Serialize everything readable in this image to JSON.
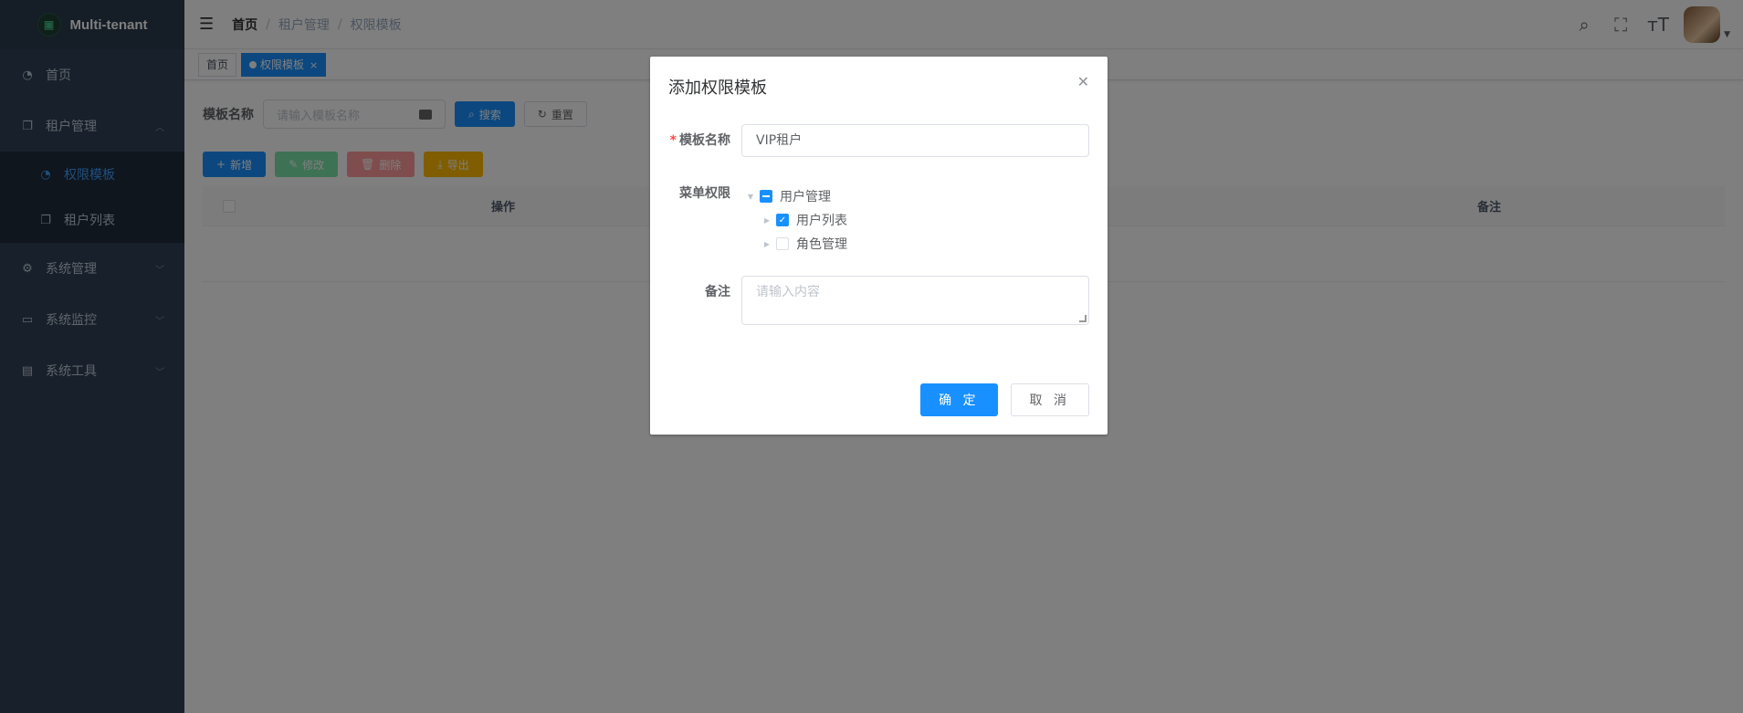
{
  "app": {
    "title": "Multi-tenant"
  },
  "sidebar": {
    "items": [
      {
        "label": "首页",
        "icon": "dashboard-icon"
      },
      {
        "label": "租户管理",
        "icon": "copy-icon",
        "expanded": true,
        "children": [
          {
            "label": "权限模板",
            "icon": "dashboard-icon",
            "active": true
          },
          {
            "label": "租户列表",
            "icon": "copy-icon"
          }
        ]
      },
      {
        "label": "系统管理",
        "icon": "gear-icon"
      },
      {
        "label": "系统监控",
        "icon": "monitor-icon"
      },
      {
        "label": "系统工具",
        "icon": "toolbox-icon"
      }
    ]
  },
  "breadcrumb": [
    "首页",
    "租户管理",
    "权限模板"
  ],
  "tags": [
    {
      "label": "首页",
      "active": false
    },
    {
      "label": "权限模板",
      "active": true
    }
  ],
  "search": {
    "label": "模板名称",
    "placeholder": "请输入模板名称",
    "search_btn": "搜索",
    "reset_btn": "重置"
  },
  "toolbar": {
    "add": "新增",
    "edit": "修改",
    "delete": "删除",
    "export": "导出"
  },
  "table": {
    "columns": [
      "操作",
      "备注"
    ]
  },
  "dialog": {
    "title": "添加权限模板",
    "name_label": "模板名称",
    "name_value": "VIP租户",
    "menu_label": "菜单权限",
    "tree": [
      {
        "label": "用户管理",
        "state": "half",
        "expanded": true,
        "children": [
          {
            "label": "用户列表",
            "state": "checked"
          },
          {
            "label": "角色管理",
            "state": "unchecked"
          }
        ]
      }
    ],
    "remark_label": "备注",
    "remark_placeholder": "请输入内容",
    "ok": "确 定",
    "cancel": "取 消"
  },
  "colors": {
    "primary": "#1890ff",
    "sidebar": "#304156"
  }
}
